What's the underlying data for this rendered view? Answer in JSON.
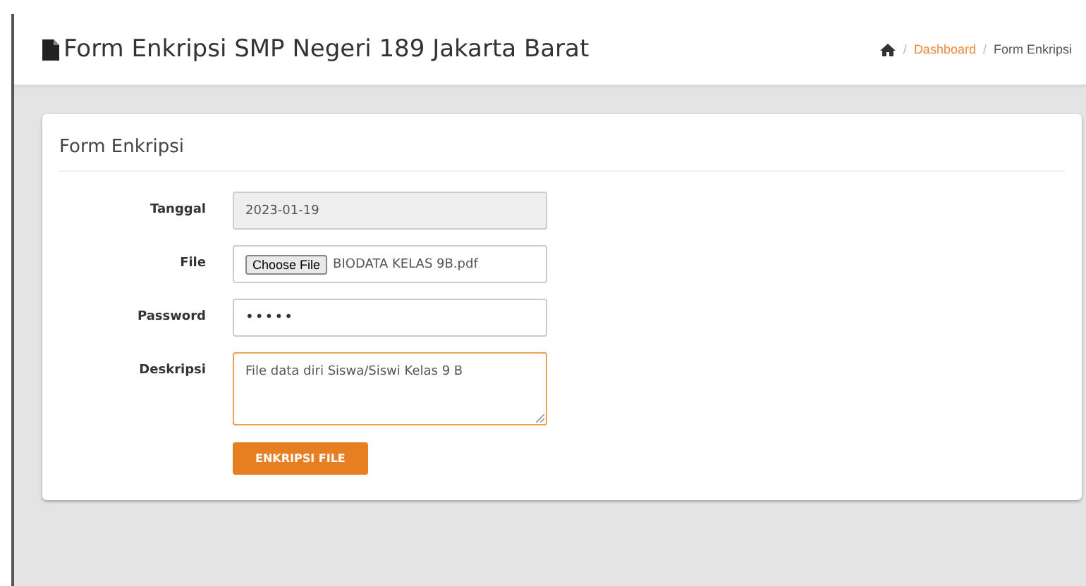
{
  "header": {
    "title": "Form Enkripsi SMP Negeri 189 Jakarta Barat",
    "breadcrumb": [
      {
        "separator": "/",
        "label": "Dashboard",
        "kind": "link"
      },
      {
        "separator": "/",
        "label": "Form Enkripsi",
        "kind": "current"
      }
    ]
  },
  "card": {
    "title": "Form Enkripsi",
    "fields": [
      {
        "kind": "text",
        "label": "Tanggal",
        "value": "2023-01-19",
        "disabled": true,
        "focused": false
      },
      {
        "kind": "file",
        "label": "File",
        "button": "Choose File",
        "value": "BIODATA KELAS 9B.pdf",
        "disabled": false,
        "focused": false
      },
      {
        "kind": "password",
        "label": "Password",
        "value": "•••••",
        "disabled": false,
        "focused": false
      },
      {
        "kind": "textarea",
        "label": "Deskripsi",
        "value": "File data diri Siswa/Siswi Kelas 9 B",
        "disabled": false,
        "focused": true
      }
    ],
    "submit": "ENKRIPSI FILE"
  }
}
